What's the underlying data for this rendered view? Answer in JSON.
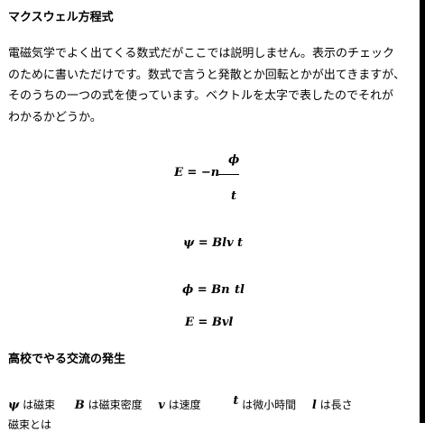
{
  "title": "マクスウェル方程式",
  "intro_lines": [
    "電磁気学でよく出てくる数式だがここでは説明しません。表示のチェック",
    "のために書いただけです。数式で言うと発散とか回転とかが出てきますが、",
    "そのうちの一つの式を使っています。ベクトルを太字で表したのでそれが",
    "わかるかどうか。"
  ],
  "equations": {
    "eq1": {
      "lhs": "E = −n",
      "numerator": "ϕ",
      "denominator": "t"
    },
    "eq2": {
      "text": "ψ = Blv",
      "tail": "t"
    },
    "eq3": {
      "text": "ϕ = Bn",
      "tail": "tl"
    },
    "eq4": {
      "text": "E = Bvl"
    }
  },
  "section2_title": "高校でやる交流の発生",
  "definitions": [
    {
      "symbol": "ψ",
      "desc": "は磁束"
    },
    {
      "symbol": "B",
      "desc": "は磁束密度"
    },
    {
      "symbol": "v",
      "desc": "は速度"
    },
    {
      "symbol": "t",
      "desc": "は微小時間"
    },
    {
      "symbol": "l",
      "desc": "は長さ"
    }
  ],
  "cutoff_text": "磁束とは"
}
